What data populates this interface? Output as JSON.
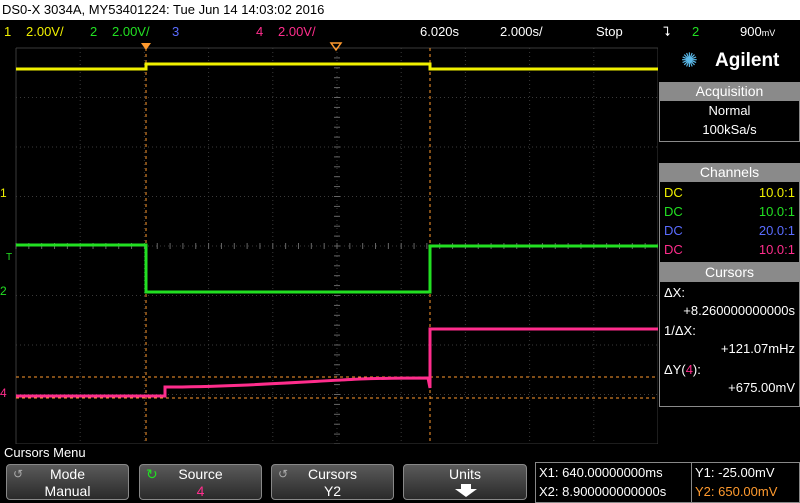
{
  "title": "DS0-X 3034A, MY53401224: Tue Jun 14 14:03:02 2016",
  "status": {
    "ch1_num": "1",
    "ch1_scale": "2.00V/",
    "ch2_num": "2",
    "ch2_scale": "2.00V/",
    "ch3_num": "3",
    "ch4_num": "4",
    "ch4_scale": "2.00V/",
    "time_pos": "6.020s",
    "time_scale": "2.000s/",
    "run_state": "Stop",
    "trigger_source": "2",
    "trigger_level": "900",
    "trigger_unit": "mV"
  },
  "brand": "Agilent",
  "acquisition": {
    "heading": "Acquisition",
    "mode": "Normal",
    "rate": "100kSa/s"
  },
  "channels": {
    "heading": "Channels",
    "rows": [
      {
        "coupling": "DC",
        "probe": "10.0:1",
        "color": "#f0f000"
      },
      {
        "coupling": "DC",
        "probe": "10.0:1",
        "color": "#22e022"
      },
      {
        "coupling": "DC",
        "probe": "20.0:1",
        "color": "#5a6cff"
      },
      {
        "coupling": "DC",
        "probe": "10.0:1",
        "color": "#ff2d8c"
      }
    ]
  },
  "cursors": {
    "heading": "Cursors",
    "dx_label": "ΔX:",
    "dx_value": "+8.260000000000s",
    "inv_dx_label": "1/ΔX:",
    "inv_dx_value": "+121.07mHz",
    "dy_label_prefix": "ΔY(",
    "dy_label_ch": "4",
    "dy_label_suffix": "):",
    "dy_value": "+675.00mV"
  },
  "menu": {
    "title": "Cursors Menu",
    "keys": [
      {
        "label": "Mode",
        "value": "Manual"
      },
      {
        "label": "Source",
        "value": "4"
      },
      {
        "label": "Cursors",
        "value": "Y2"
      },
      {
        "label": "Units",
        "value": ""
      }
    ]
  },
  "readout": {
    "x1": "X1: 640.00000000ms",
    "x2": "X2: 8.900000000000s",
    "y1": "Y1: -25.00mV",
    "y2": "Y2: 650.00mV"
  },
  "markers": {
    "ch1": "1",
    "ch2": "2",
    "ch4": "4",
    "trig": "T"
  },
  "colors": {
    "ch1": "#f0f000",
    "ch2": "#22e022",
    "ch3": "#5a6cff",
    "ch4": "#ff2d8c",
    "cursor": "#ff9a2e",
    "grid": "#3a3a3a",
    "panel": "#8a8a8a"
  }
}
